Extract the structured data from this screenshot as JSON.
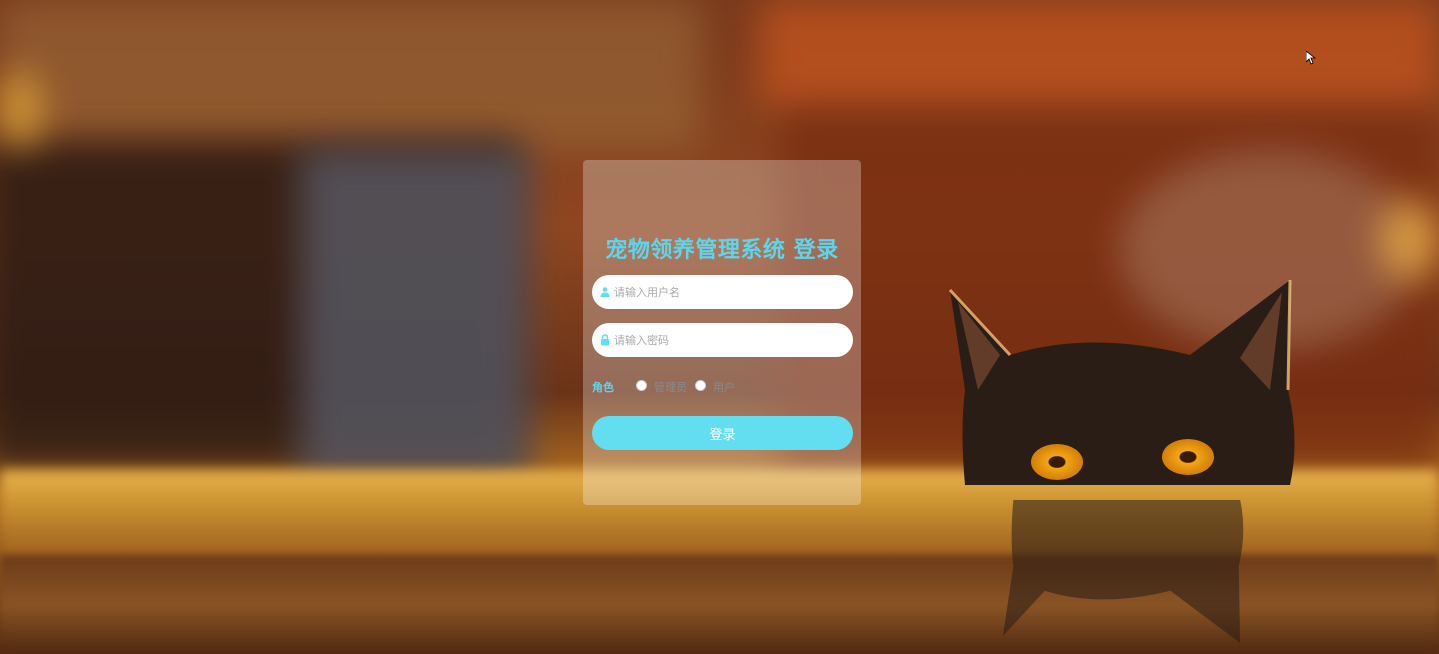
{
  "login": {
    "title": "宠物领养管理系统 登录",
    "username_placeholder": "请输入用户名",
    "password_placeholder": "请输入密码",
    "role_label": "角色",
    "role_options": [
      "管理员",
      "用户"
    ],
    "submit_label": "登录"
  },
  "icons": {
    "username": "user-icon",
    "password": "lock-icon"
  },
  "colors": {
    "accent": "#5fd5ec",
    "button": "#63def0"
  }
}
